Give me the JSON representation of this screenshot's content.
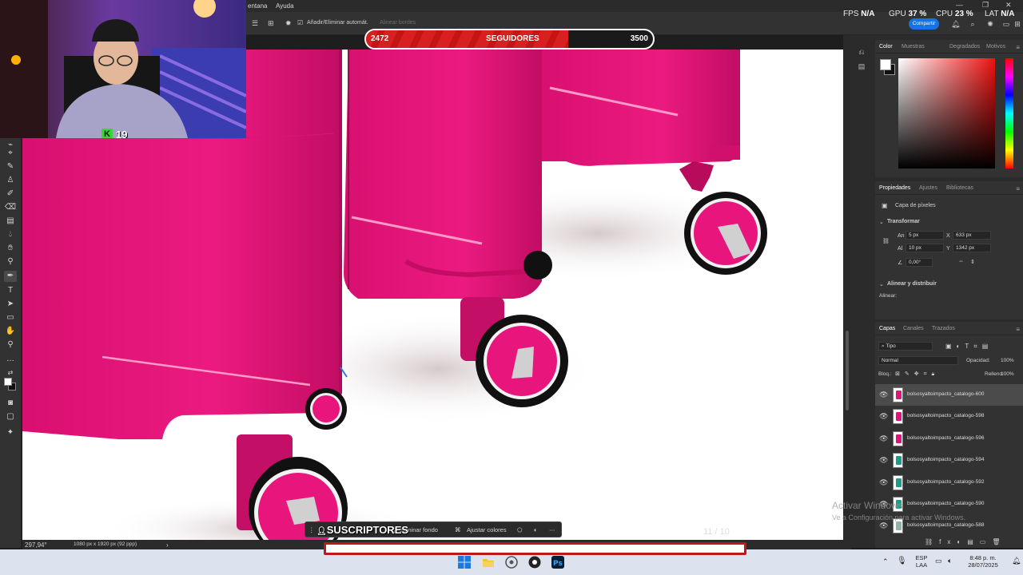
{
  "menubar": {
    "items": [
      "entana",
      "Ayuda"
    ]
  },
  "options_bar": {
    "auto_add_remove": "Añadir/Eliminar automát.",
    "align_edges": "Alinear bordes",
    "share_label": "Compartir"
  },
  "stats": {
    "fps_label": "FPS",
    "fps_value": "N/A",
    "gpu_label": "GPU",
    "gpu_value": "37 %",
    "cpu_label": "CPU",
    "cpu_value": "23 %",
    "lat_label": "LAT",
    "lat_value": "N/A"
  },
  "followers_bar": {
    "current": "2472",
    "label": "SEGUIDORES",
    "goal": "3500",
    "progress_fraction": 0.706
  },
  "webcam": {
    "badge_letter": "K",
    "badge_number": "19"
  },
  "color_panel": {
    "tabs": [
      "Color",
      "Muestras",
      "Degradados",
      "Motivos"
    ],
    "accent": "#f01010"
  },
  "properties_panel": {
    "tabs": [
      "Propiedades",
      "Ajustes",
      "Bibliotecas"
    ],
    "layer_kind": "Capa de píxeles",
    "transform_title": "Transformar",
    "w_label": "An",
    "w_value": "5 px",
    "h_label": "Al",
    "h_value": "10 px",
    "x_label": "X",
    "x_value": "633 px",
    "y_label": "Y",
    "y_value": "1342 px",
    "angle_value": "0,00°",
    "align_title": "Alinear y distribuir",
    "align_label": "Alinear:"
  },
  "layers_panel": {
    "tabs": [
      "Capas",
      "Canales",
      "Trazados"
    ],
    "filter_label": "Tipo",
    "blend_mode": "Normal",
    "opacity_label": "Opacidad:",
    "opacity_value": "100%",
    "lock_label": "Bloq.:",
    "fill_label": "Relleno:",
    "fill_value": "100%",
    "layers": [
      {
        "name": "bolsosyaltoimpacto_catalogo-600",
        "color": "#e0157a",
        "selected": true
      },
      {
        "name": "bolsosyaltoimpacto_catalogo-598",
        "color": "#e0157a",
        "selected": false
      },
      {
        "name": "bolsosyaltoimpacto_catalogo-596",
        "color": "#e0157a",
        "selected": false
      },
      {
        "name": "bolsosyaltoimpacto_catalogo-594",
        "color": "#1a9e8a",
        "selected": false
      },
      {
        "name": "bolsosyaltoimpacto_catalogo-592",
        "color": "#1a9e8a",
        "selected": false
      },
      {
        "name": "bolsosyaltoimpacto_catalogo-590",
        "color": "#1a9e8a",
        "selected": false
      },
      {
        "name": "bolsosyaltoimpacto_catalogo-588",
        "color": "#8fb4a8",
        "selected": false
      }
    ]
  },
  "status_bar": {
    "zoom": "297,94°",
    "doc_size": "1080 px x 1920 px (92 ppp)"
  },
  "context_taskbar": {
    "remove_bg": "Eliminar fondo",
    "adjust_colors": "Ajustar colores"
  },
  "overlays": {
    "subscribers_label": "SUSCRIPTORES",
    "page_counter": "11 / 10"
  },
  "watermark": {
    "line1": "Activar Windows",
    "line2": "Ve a Configuración para activar Windows."
  },
  "windows_taskbar": {
    "lang_line1": "ESP",
    "lang_line2": "LAA",
    "time": "8:48 p. m.",
    "date": "28/07/2025"
  },
  "canvas": {
    "luggage_color": "#e8167c",
    "wheel_hub_color": "#d0d0d0"
  }
}
